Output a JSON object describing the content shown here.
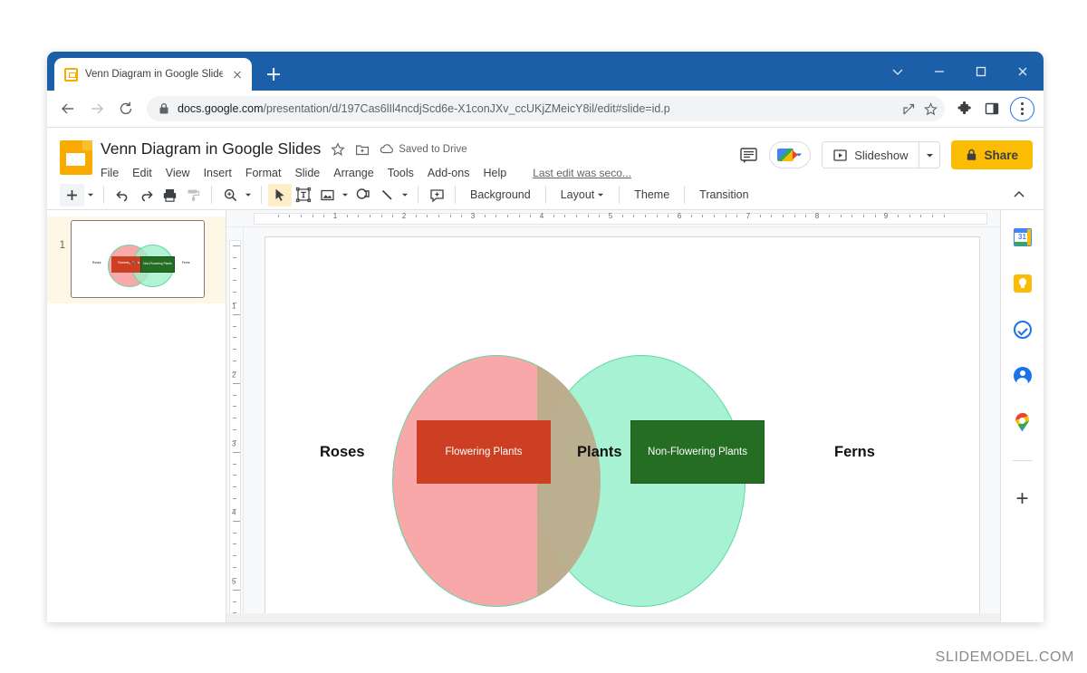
{
  "browser": {
    "tab": {
      "title": "Venn Diagram in Google Slides -",
      "favicon": "slides-favicon",
      "close": "close-icon"
    },
    "new_tab_label": "+",
    "window_controls": [
      "chevron-down-icon",
      "minimize-icon",
      "maximize-icon",
      "close-icon"
    ],
    "nav": {
      "back": "back-arrow-icon",
      "forward": "forward-arrow-icon",
      "reload": "reload-icon"
    },
    "omnibox": {
      "lock": "lock-icon",
      "host": "docs.google.com",
      "path": "/presentation/d/197Cas6lIl4ncdjScd6e-X1conJXv_ccUKjZMeicY8il/edit#slide=id.p",
      "share": "share-icon",
      "bookmark": "star-icon"
    },
    "toolbar_icons": [
      "extensions-puzzle-icon",
      "side-panel-icon",
      "chrome-menu-icon"
    ]
  },
  "slides": {
    "logo": "google-slides-logo",
    "doc_title": "Venn Diagram in Google Slides",
    "star": "star-icon",
    "move": "move-to-folder-icon",
    "saved_status": "Saved to Drive",
    "menus": [
      "File",
      "Edit",
      "View",
      "Insert",
      "Format",
      "Slide",
      "Arrange",
      "Tools",
      "Add-ons",
      "Help"
    ],
    "last_edit": "Last edit was seco...",
    "comment_icon": "comment-history-icon",
    "meet_label": "meet-camera-icon",
    "slideshow_label": "Slideshow",
    "share_label": "Share"
  },
  "toolbar": {
    "new_slide": "plus-icon",
    "undo": "undo-icon",
    "redo": "redo-icon",
    "print": "print-icon",
    "paint_format": "paint-format-icon",
    "zoom": "zoom-icon",
    "select": "cursor-arrow-icon",
    "textbox": "text-box-icon",
    "image": "image-icon",
    "shape": "shape-icon",
    "line": "line-icon",
    "comment": "add-comment-icon",
    "background_label": "Background",
    "layout_label": "Layout",
    "theme_label": "Theme",
    "transition_label": "Transition",
    "collapse": "chevron-up-icon"
  },
  "filmstrip": {
    "slides": [
      {
        "number": "1"
      }
    ]
  },
  "rulers": {
    "horizontal": [
      "1",
      "2",
      "3",
      "4",
      "5",
      "6",
      "7",
      "8",
      "9"
    ],
    "vertical": [
      "1",
      "2",
      "3",
      "4",
      "5"
    ]
  },
  "rail": {
    "items": [
      {
        "name": "google-calendar-icon"
      },
      {
        "name": "google-keep-icon"
      },
      {
        "name": "google-tasks-icon"
      },
      {
        "name": "google-contacts-icon"
      },
      {
        "name": "google-maps-icon"
      }
    ],
    "add_label": "+"
  },
  "chart_data": {
    "type": "venn",
    "title": "Venn Diagram in Google Slides",
    "sets": [
      {
        "name": "Roses",
        "outside_label": "Roses",
        "inner_label": "Flowering Plants",
        "fill": "#f8a3a3",
        "box_fill": "#cc3f22",
        "stroke": "#5fd7a5"
      },
      {
        "name": "Ferns",
        "outside_label": "Ferns",
        "inner_label": "Non-Flowering Plants",
        "fill": "#9df1cd",
        "box_fill": "#256d23",
        "stroke": "#5fd7a5"
      }
    ],
    "intersection": {
      "label": "Plants",
      "fill": "#baad8b"
    },
    "labels": {
      "left": "Roses",
      "center": "Plants",
      "right": "Ferns",
      "left_box": "Flowering Plants",
      "right_box": "Non-Flowering Plants"
    }
  },
  "watermark": "SLIDEMODEL.COM",
  "colors": {
    "chrome_tabstrip": "#1a5fa8",
    "slides_yellow": "#f9ab00",
    "share_yellow": "#fbbc04",
    "accent_blue": "#1a73e8",
    "selected_slide_bg": "#fef7e6"
  }
}
